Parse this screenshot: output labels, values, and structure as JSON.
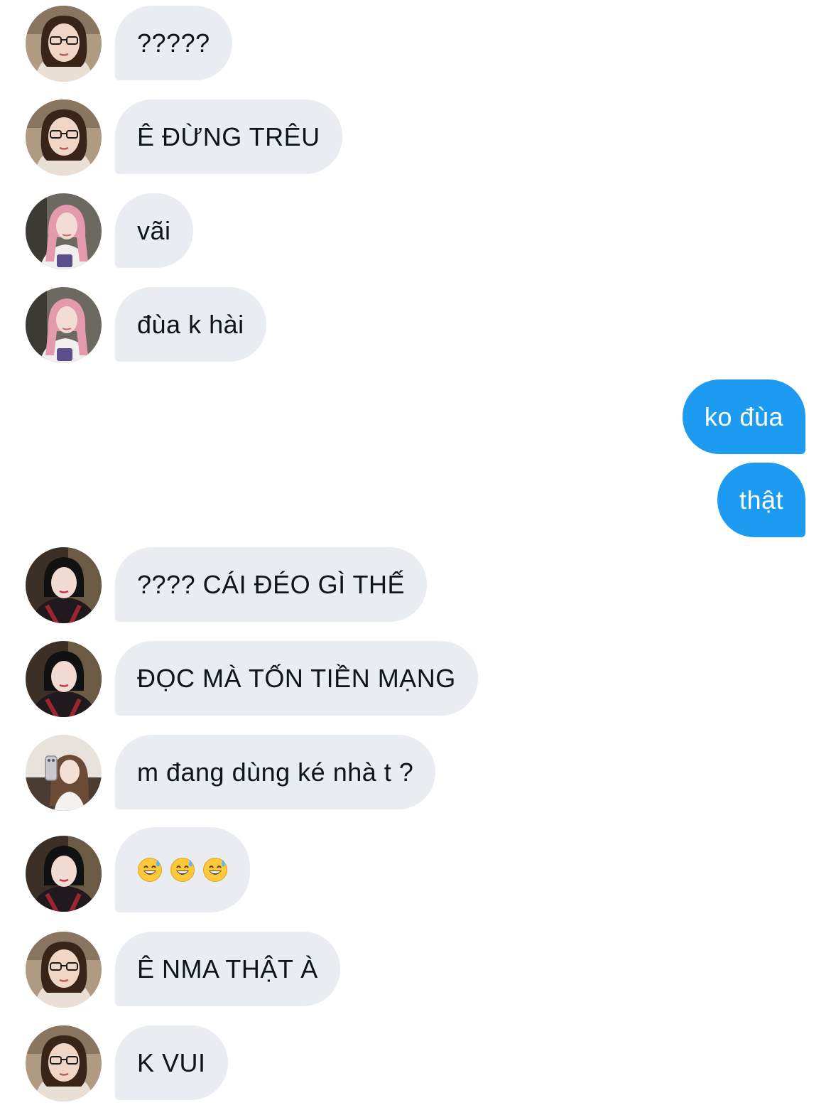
{
  "messages": [
    {
      "sender": "other",
      "avatar": "glasses-girl",
      "text": "?????"
    },
    {
      "sender": "other",
      "avatar": "glasses-girl",
      "text": "Ê ĐỪNG TRÊU"
    },
    {
      "sender": "other",
      "avatar": "pink-hair-girl",
      "text": "vãi"
    },
    {
      "sender": "other",
      "avatar": "pink-hair-girl",
      "text": "đùa k hài"
    },
    {
      "sender": "me",
      "text": "ko đùa"
    },
    {
      "sender": "me",
      "text": "thật"
    },
    {
      "sender": "other",
      "avatar": "black-bob-girl",
      "text": "???? CÁI ĐÉO GÌ THẾ"
    },
    {
      "sender": "other",
      "avatar": "black-bob-girl",
      "text": "ĐỌC MÀ TỐN TIỀN MẠNG"
    },
    {
      "sender": "other",
      "avatar": "selfie-girl",
      "text": "m đang dùng ké nhà t ?"
    },
    {
      "sender": "other",
      "avatar": "black-bob-girl",
      "emoji": [
        "sweat-smile-emoji",
        "sweat-smile-emoji",
        "sweat-smile-emoji"
      ]
    },
    {
      "sender": "other",
      "avatar": "glasses-girl",
      "text": "Ê NMA THẬT À"
    },
    {
      "sender": "other",
      "avatar": "glasses-girl",
      "text": "K VUI"
    }
  ],
  "colors": {
    "incoming_bubble": "#e9edf1",
    "outgoing_bubble": "#1d9bf0",
    "incoming_text": "#0f1419",
    "outgoing_text": "#ffffff"
  }
}
